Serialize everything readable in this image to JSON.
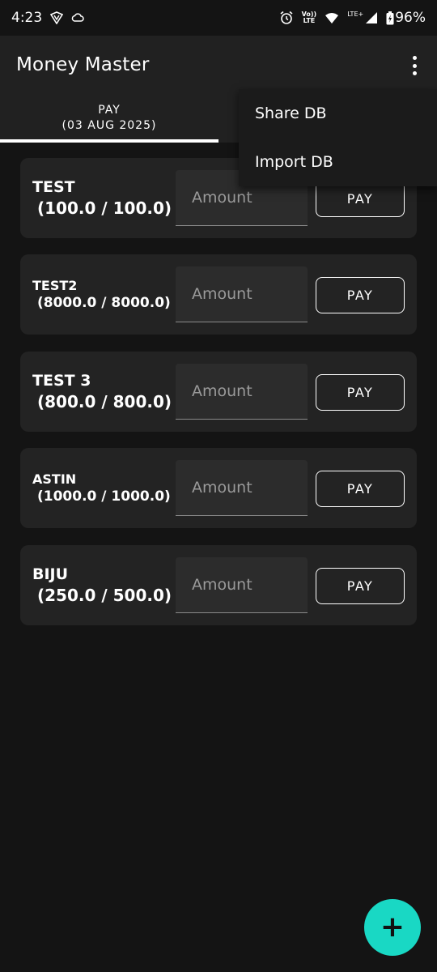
{
  "status_bar": {
    "time": "4:23",
    "network_label_top": "Vo))",
    "network_label_bottom": "LTE",
    "signal_label": "LTE+",
    "battery": "96%"
  },
  "app_bar": {
    "title": "Money Master"
  },
  "tabs": [
    {
      "label": "PAY",
      "sub_label": "(03 AUG 2025)",
      "selected": true
    }
  ],
  "menu": {
    "items": [
      {
        "label": "Share DB"
      },
      {
        "label": "Import DB"
      }
    ]
  },
  "list": {
    "amount_placeholder": "Amount",
    "pay_label": "PAY",
    "items": [
      {
        "name": "TEST",
        "amount": "(100.0 / 100.0)"
      },
      {
        "name": "TEST2",
        "amount": "(8000.0 / 8000.0)"
      },
      {
        "name": "TEST 3",
        "amount": "(800.0 / 800.0)"
      },
      {
        "name": "ASTIN",
        "amount": "(1000.0 / 1000.0)"
      },
      {
        "name": "BIJU",
        "amount": "(250.0 / 500.0)"
      }
    ]
  },
  "fab": {
    "label": "+"
  },
  "colors": {
    "background": "#141414",
    "app_bar": "#212121",
    "card": "#232323",
    "accent": "#19d8c4"
  }
}
